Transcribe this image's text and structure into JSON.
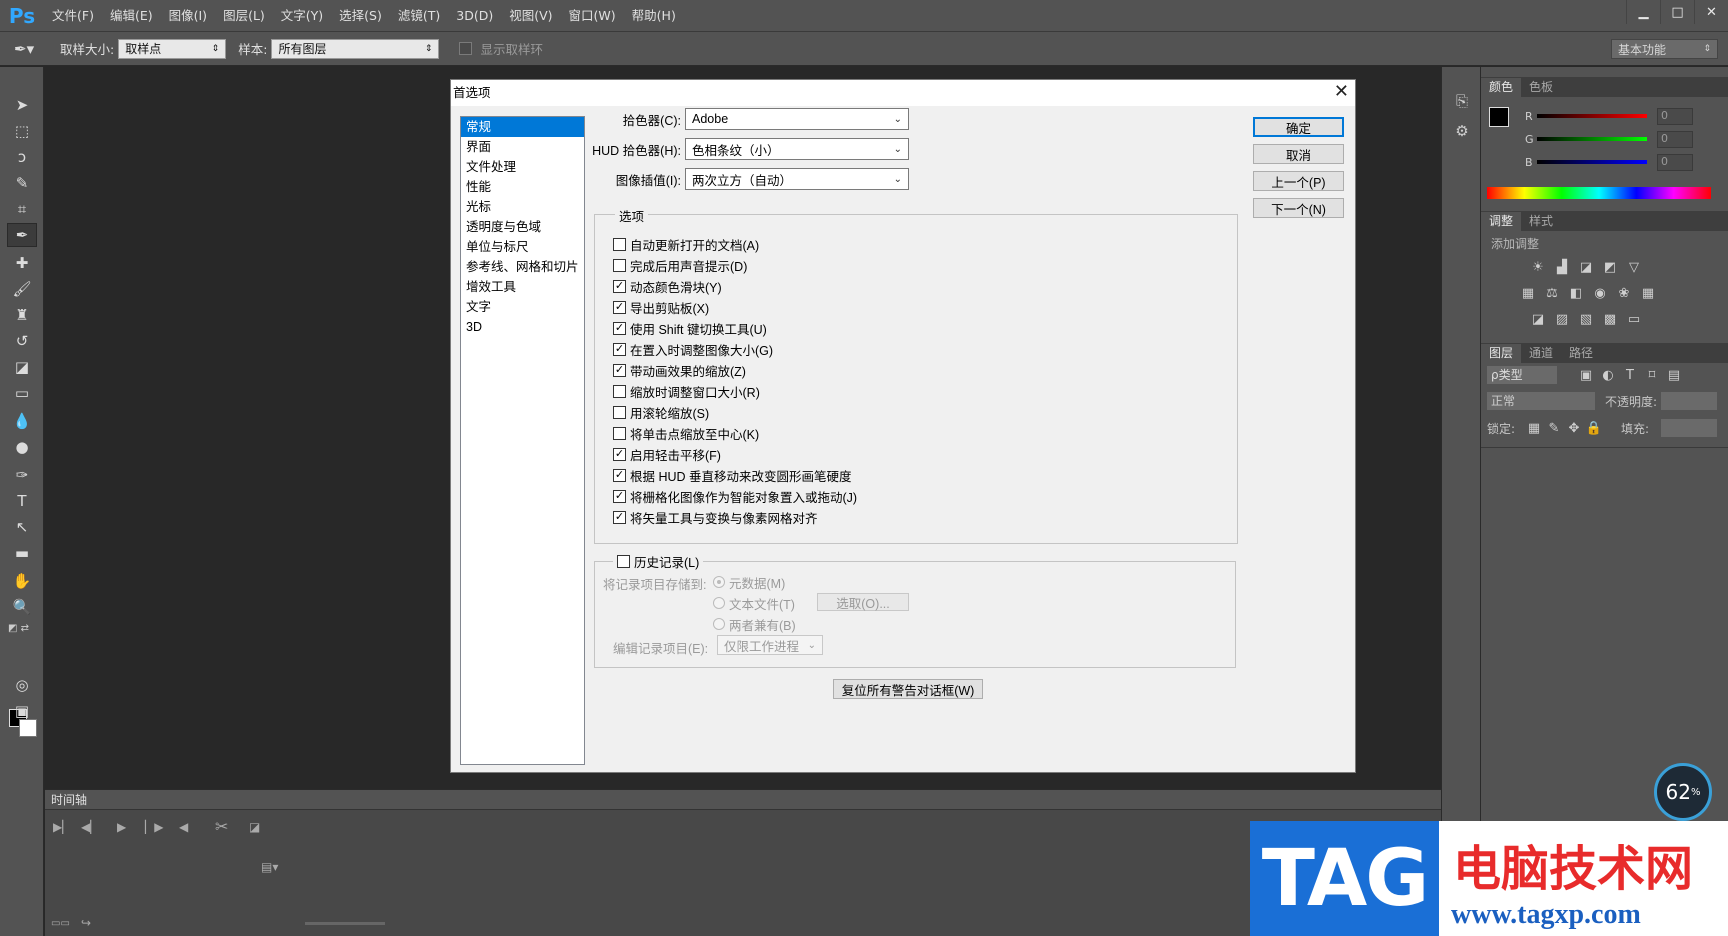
{
  "app": {
    "logo": "Ps"
  },
  "menu": [
    "文件(F)",
    "编辑(E)",
    "图像(I)",
    "图层(L)",
    "文字(Y)",
    "选择(S)",
    "滤镜(T)",
    "3D(D)",
    "视图(V)",
    "窗口(W)",
    "帮助(H)"
  ],
  "window_controls": {
    "minimize": "▁",
    "maximize": "□",
    "close": "✕"
  },
  "options_bar": {
    "sample_size_label": "取样大小:",
    "sample_size_value": "取样点",
    "sample_label": "样本:",
    "sample_value": "所有图层",
    "show_ring_label": "显示取样环",
    "workspace": "基本功能"
  },
  "timeline": {
    "title": "时间轴"
  },
  "panels": {
    "color_tabs": [
      "颜色",
      "色板"
    ],
    "sliders": [
      {
        "letter": "R",
        "value": "0"
      },
      {
        "letter": "G",
        "value": "0"
      },
      {
        "letter": "B",
        "value": "0"
      }
    ],
    "adjust_tabs": [
      "调整",
      "样式"
    ],
    "adjust_title": "添加调整",
    "layers_tabs": [
      "图层",
      "通道",
      "路径"
    ],
    "layer_kind": "ρ类型",
    "blend_mode": "正常",
    "opacity_label": "不透明度:",
    "lock_label": "锁定:",
    "fill_label": "填充:"
  },
  "dialog": {
    "title": "首选项",
    "categories": [
      "常规",
      "界面",
      "文件处理",
      "性能",
      "光标",
      "透明度与色域",
      "单位与标尺",
      "参考线、网格和切片",
      "增效工具",
      "文字",
      "3D"
    ],
    "selected_category": "常规",
    "color_picker_label": "拾色器(C):",
    "color_picker_value": "Adobe",
    "hud_picker_label": "HUD 拾色器(H):",
    "hud_picker_value": "色相条纹（小）",
    "interp_label": "图像插值(I):",
    "interp_value": "两次立方（自动）",
    "options_legend": "选项",
    "options": [
      {
        "label": "自动更新打开的文档(A)",
        "checked": false
      },
      {
        "label": "完成后用声音提示(D)",
        "checked": false
      },
      {
        "label": "动态颜色滑块(Y)",
        "checked": true
      },
      {
        "label": "导出剪贴板(X)",
        "checked": true
      },
      {
        "label": "使用 Shift 键切换工具(U)",
        "checked": true
      },
      {
        "label": "在置入时调整图像大小(G)",
        "checked": true
      },
      {
        "label": "带动画效果的缩放(Z)",
        "checked": true
      },
      {
        "label": "缩放时调整窗口大小(R)",
        "checked": false
      },
      {
        "label": "用滚轮缩放(S)",
        "checked": false
      },
      {
        "label": "将单击点缩放至中心(K)",
        "checked": false
      },
      {
        "label": "启用轻击平移(F)",
        "checked": true
      },
      {
        "label": "根据 HUD 垂直移动来改变圆形画笔硬度",
        "checked": true
      },
      {
        "label": "将栅格化图像作为智能对象置入或拖动(J)",
        "checked": true
      },
      {
        "label": "将矢量工具与变换与像素网格对齐",
        "checked": true
      }
    ],
    "history_label": "历史记录(L)",
    "save_to_label": "将记录项目存储到:",
    "radio_metadata": "元数据(M)",
    "radio_textfile": "文本文件(T)",
    "radio_both": "两者兼有(B)",
    "choose_button": "选取(O)...",
    "edit_log_label": "编辑记录项目(E):",
    "edit_log_value": "仅限工作进程",
    "reset_warnings": "复位所有警告对话框(W)",
    "ok": "确定",
    "cancel": "取消",
    "prev": "上一个(P)",
    "next": "下一个(N)",
    "close": "✕"
  },
  "watermark": {
    "tag": "TAG",
    "site_cn": "电脑技术网",
    "url": "www.tagxp.com"
  },
  "gauge": {
    "value": "62",
    "unit": "%"
  }
}
